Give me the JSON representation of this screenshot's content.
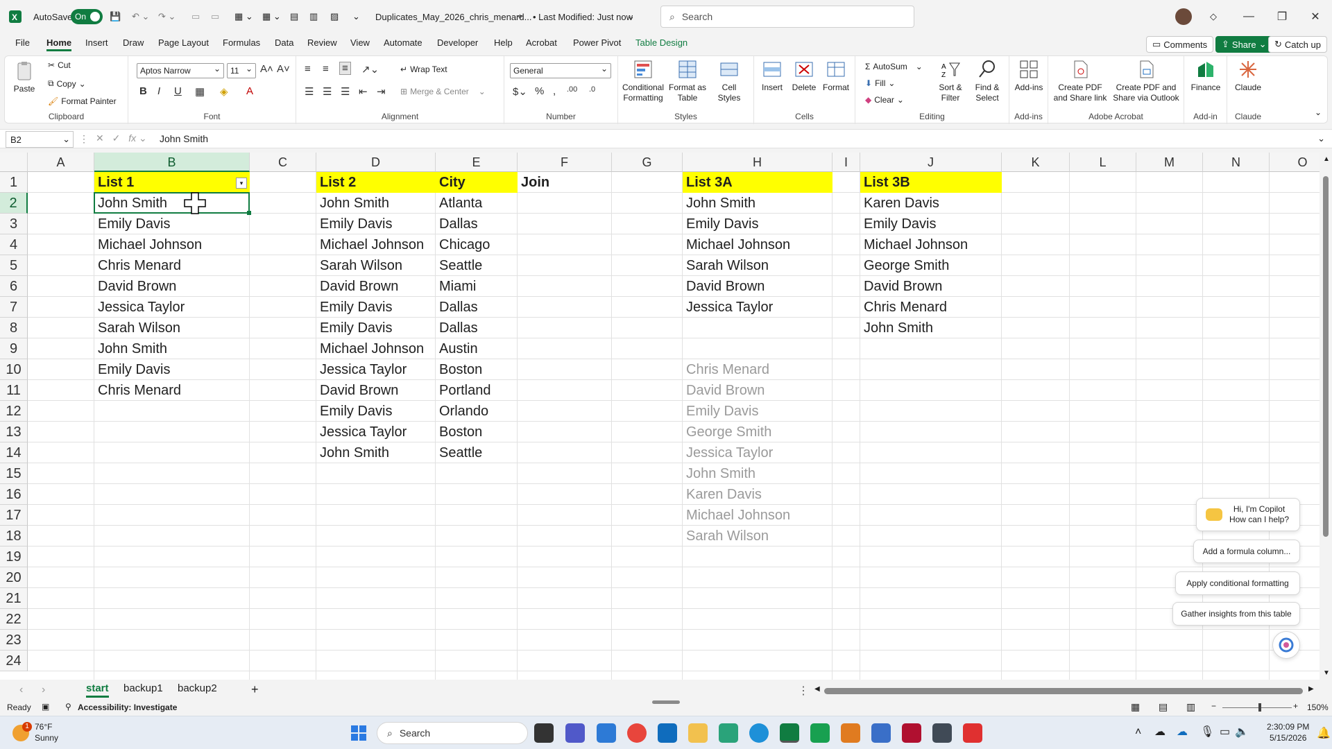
{
  "titlebar": {
    "autosave_label": "AutoSave",
    "autosave_state": "On",
    "filename": "Duplicates_May_2026_chris_menard...",
    "modified": "• Last Modified: Just now",
    "search_placeholder": "Search"
  },
  "menu": {
    "tabs": [
      "File",
      "Home",
      "Insert",
      "Draw",
      "Page Layout",
      "Formulas",
      "Data",
      "Review",
      "View",
      "Automate",
      "Developer",
      "Help",
      "Acrobat",
      "Power Pivot",
      "Table Design"
    ],
    "comments": "Comments",
    "share": "Share",
    "catchup": "Catch up"
  },
  "ribbon": {
    "clipboard": {
      "paste": "Paste",
      "cut": "Cut",
      "copy": "Copy",
      "format_painter": "Format Painter",
      "label": "Clipboard"
    },
    "font": {
      "name": "Aptos Narrow",
      "size": "11",
      "label": "Font"
    },
    "alignment": {
      "wrap": "Wrap Text",
      "merge": "Merge & Center",
      "label": "Alignment"
    },
    "number": {
      "format": "General",
      "label": "Number"
    },
    "styles": {
      "conditional": "Conditional Formatting",
      "format_table": "Format as Table",
      "cell_styles": "Cell Styles",
      "label": "Styles"
    },
    "cells": {
      "insert": "Insert",
      "delete": "Delete",
      "format": "Format",
      "label": "Cells"
    },
    "editing": {
      "autosum": "AutoSum",
      "fill": "Fill",
      "clear": "Clear",
      "sort": "Sort & Filter",
      "find": "Find & Select",
      "label": "Editing"
    },
    "addins": {
      "addins": "Add-ins",
      "label": "Add-ins"
    },
    "acrobat": {
      "create_pdf": "Create PDF and Share link",
      "create_pdf_outlook": "Create PDF and Share via Outlook",
      "label": "Adobe Acrobat"
    },
    "finance": {
      "finance": "Finance",
      "label": "Add-in"
    },
    "claude": {
      "claude": "Claude",
      "label": "Claude"
    }
  },
  "formula_bar": {
    "name_box": "B2",
    "fx": "fx",
    "content": "John Smith"
  },
  "columns": [
    "A",
    "B",
    "C",
    "D",
    "E",
    "F",
    "G",
    "H",
    "I",
    "J",
    "K",
    "L",
    "M",
    "N",
    "O"
  ],
  "rows": [
    "1",
    "2",
    "3",
    "4",
    "5",
    "6",
    "7",
    "8",
    "9",
    "10",
    "11",
    "12",
    "13",
    "14",
    "15",
    "16",
    "17",
    "18",
    "19",
    "20",
    "21",
    "22",
    "23",
    "24"
  ],
  "sheet": {
    "list1_header": "List 1",
    "list1": [
      "John Smith",
      "Emily Davis",
      "Michael Johnson",
      "Chris Menard",
      "David Brown",
      "Jessica Taylor",
      "Sarah Wilson",
      "John Smith",
      "Emily Davis",
      "Chris Menard"
    ],
    "list2_header": "List 2",
    "city_header": "City",
    "join_header": "Join",
    "list2": [
      "John Smith",
      "Emily Davis",
      "Michael Johnson",
      "Sarah Wilson",
      "David Brown",
      "Emily Davis",
      "Emily Davis",
      "Michael Johnson",
      "Jessica Taylor",
      "David Brown",
      "Emily Davis",
      "Jessica Taylor",
      "John Smith"
    ],
    "cities": [
      "Atlanta",
      "Dallas",
      "Chicago",
      "Seattle",
      "Miami",
      "Dallas",
      "Dallas",
      "Austin",
      "Boston",
      "Portland",
      "Orlando",
      "Boston",
      "Seattle"
    ],
    "list3a_header": "List 3A",
    "list3a": [
      "John Smith",
      "Emily Davis",
      "Michael Johnson",
      "Sarah Wilson",
      "David Brown",
      "Jessica Taylor"
    ],
    "list3b_header": "List 3B",
    "list3b": [
      "Karen Davis",
      "Emily Davis",
      "Michael Johnson",
      "George Smith",
      "David Brown",
      "Chris Menard",
      "John Smith"
    ],
    "ghost_list": [
      "Chris Menard",
      "David Brown",
      "Emily Davis",
      "George Smith",
      "Jessica Taylor",
      "John Smith",
      "Karen Davis",
      "Michael Johnson",
      "Sarah Wilson"
    ]
  },
  "copilot": {
    "greeting": "Hi, I'm Copilot How can I help?",
    "suggestion1": "Add a formula column...",
    "suggestion2": "Apply conditional formatting",
    "suggestion3": "Gather insights from this table"
  },
  "sheet_tabs": [
    "start",
    "backup1",
    "backup2"
  ],
  "status": {
    "ready": "Ready",
    "accessibility": "Accessibility: Investigate",
    "zoom": "150%"
  },
  "taskbar": {
    "weather_temp": "76°F",
    "weather_desc": "Sunny",
    "search": "Search",
    "time": "2:30:09 PM",
    "date": "5/15/2026",
    "badge": "1"
  },
  "colors": {
    "excel_green": "#107c41",
    "header_yellow": "#ffff00"
  }
}
